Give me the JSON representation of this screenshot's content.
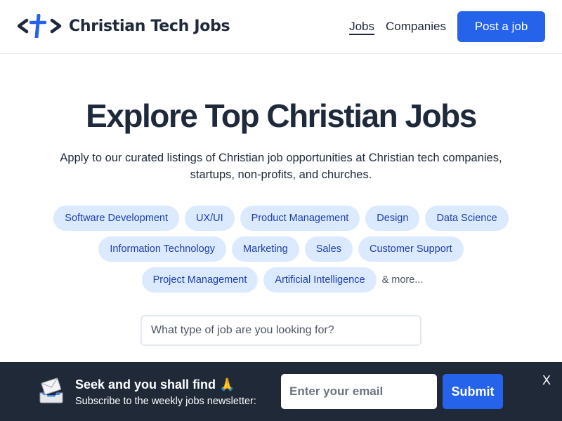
{
  "header": {
    "logo_text": "Christian Tech Jobs",
    "nav": [
      {
        "label": "Jobs",
        "active": true
      },
      {
        "label": "Companies",
        "active": false
      }
    ],
    "post_job_label": "Post a job"
  },
  "hero": {
    "title": "Explore Top Christian Jobs",
    "subtitle": "Apply to our curated listings of Christian job opportunities at Christian tech companies, startups, non-profits, and churches."
  },
  "tags": {
    "rows": [
      [
        "Software Development",
        "UX/UI",
        "Product Management",
        "Design",
        "Data Science"
      ],
      [
        "Information Technology",
        "Marketing",
        "Sales",
        "Customer Support"
      ],
      [
        "Project Management",
        "Artificial Intelligence"
      ]
    ],
    "more_label": "& more..."
  },
  "search": {
    "placeholder": "What type of job are you looking for?",
    "value": ""
  },
  "newsletter": {
    "title": "Seek and you shall find 🙏",
    "subtitle": "Subscribe to the weekly jobs newsletter:",
    "email_placeholder": "Enter your email",
    "submit_label": "Submit",
    "close_label": "X"
  },
  "colors": {
    "accent": "#2563eb",
    "text_dark": "#1e293b",
    "tag_bg": "#dbeafe",
    "tag_text": "#1e40af",
    "banner_bg": "#1f2937"
  }
}
